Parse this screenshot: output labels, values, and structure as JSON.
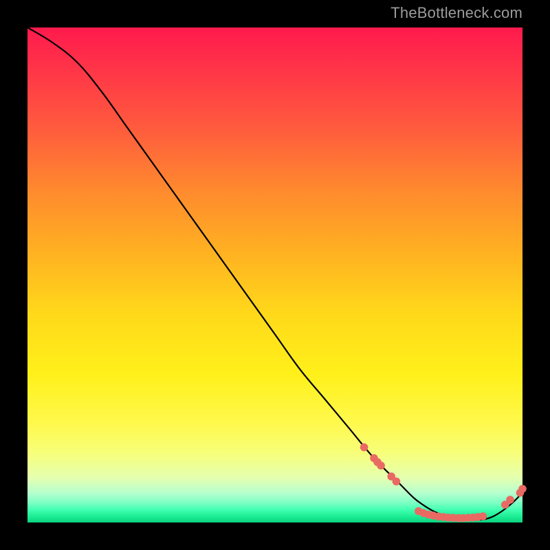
{
  "watermark": "TheBottleneck.com",
  "colors": {
    "curve_stroke": "#000000",
    "marker_fill": "#e96a63",
    "marker_stroke": "#e96a63"
  },
  "chart_data": {
    "type": "line",
    "title": "",
    "xlabel": "",
    "ylabel": "",
    "xlim": [
      0,
      100
    ],
    "ylim": [
      0,
      100
    ],
    "grid": false,
    "legend": false,
    "series": [
      {
        "name": "bottleneck-curve",
        "x": [
          0,
          5,
          10,
          15,
          20,
          25,
          30,
          35,
          40,
          45,
          50,
          55,
          60,
          65,
          70,
          75,
          78,
          80,
          82,
          84,
          86,
          88,
          90,
          92,
          94,
          96,
          98,
          100
        ],
        "y": [
          100,
          97,
          93,
          87,
          80,
          73,
          66,
          59,
          52,
          45,
          38,
          31,
          25,
          19,
          13,
          8,
          5,
          3.5,
          2.3,
          1.5,
          1,
          0.7,
          0.6,
          0.6,
          1.2,
          2.4,
          4,
          6
        ]
      }
    ],
    "markers": [
      {
        "x": 68,
        "y": 15.2
      },
      {
        "x": 70,
        "y": 13
      },
      {
        "x": 70.7,
        "y": 12.2
      },
      {
        "x": 71.4,
        "y": 11.5
      },
      {
        "x": 73.5,
        "y": 9.3
      },
      {
        "x": 74.5,
        "y": 8.3
      },
      {
        "x": 79,
        "y": 2.3
      },
      {
        "x": 80,
        "y": 1.9
      },
      {
        "x": 81,
        "y": 1.6
      },
      {
        "x": 82,
        "y": 1.4
      },
      {
        "x": 83,
        "y": 1.2
      },
      {
        "x": 84,
        "y": 1.1
      },
      {
        "x": 85,
        "y": 1.0
      },
      {
        "x": 86,
        "y": 0.95
      },
      {
        "x": 87,
        "y": 0.9
      },
      {
        "x": 88,
        "y": 0.9
      },
      {
        "x": 89,
        "y": 0.95
      },
      {
        "x": 90,
        "y": 1.0
      },
      {
        "x": 91,
        "y": 1.1
      },
      {
        "x": 92,
        "y": 1.25
      },
      {
        "x": 96.5,
        "y": 3.6
      },
      {
        "x": 97.5,
        "y": 4.6
      },
      {
        "x": 99.5,
        "y": 6.0
      },
      {
        "x": 100,
        "y": 6.8
      }
    ]
  }
}
